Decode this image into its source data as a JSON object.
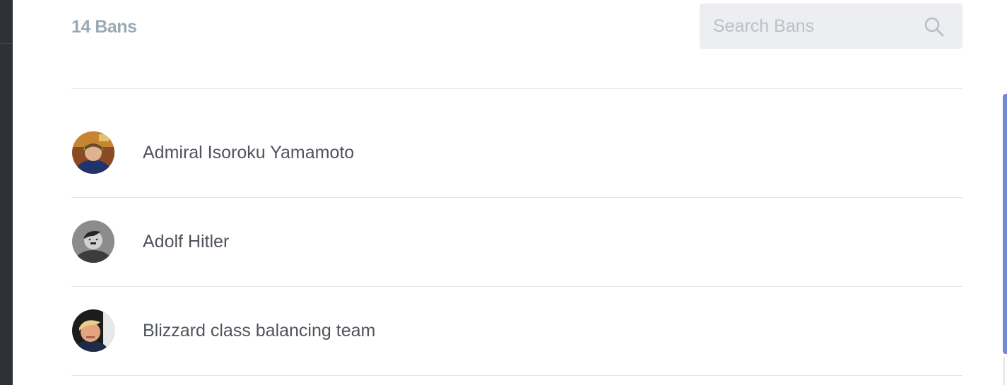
{
  "header": {
    "ban_count": "14 Bans"
  },
  "search": {
    "placeholder": "Search Bans",
    "value": "",
    "icon": "search-icon"
  },
  "bans": [
    {
      "name": "Admiral Isoroku Yamamoto",
      "avatar": "user-avatar"
    },
    {
      "name": "Adolf Hitler",
      "avatar": "user-avatar"
    },
    {
      "name": "Blizzard class balancing team",
      "avatar": "user-avatar"
    }
  ],
  "colors": {
    "accent": "#7289da",
    "muted_text": "#99aab5",
    "body_text": "#4f545c",
    "search_bg": "#eceef1"
  }
}
